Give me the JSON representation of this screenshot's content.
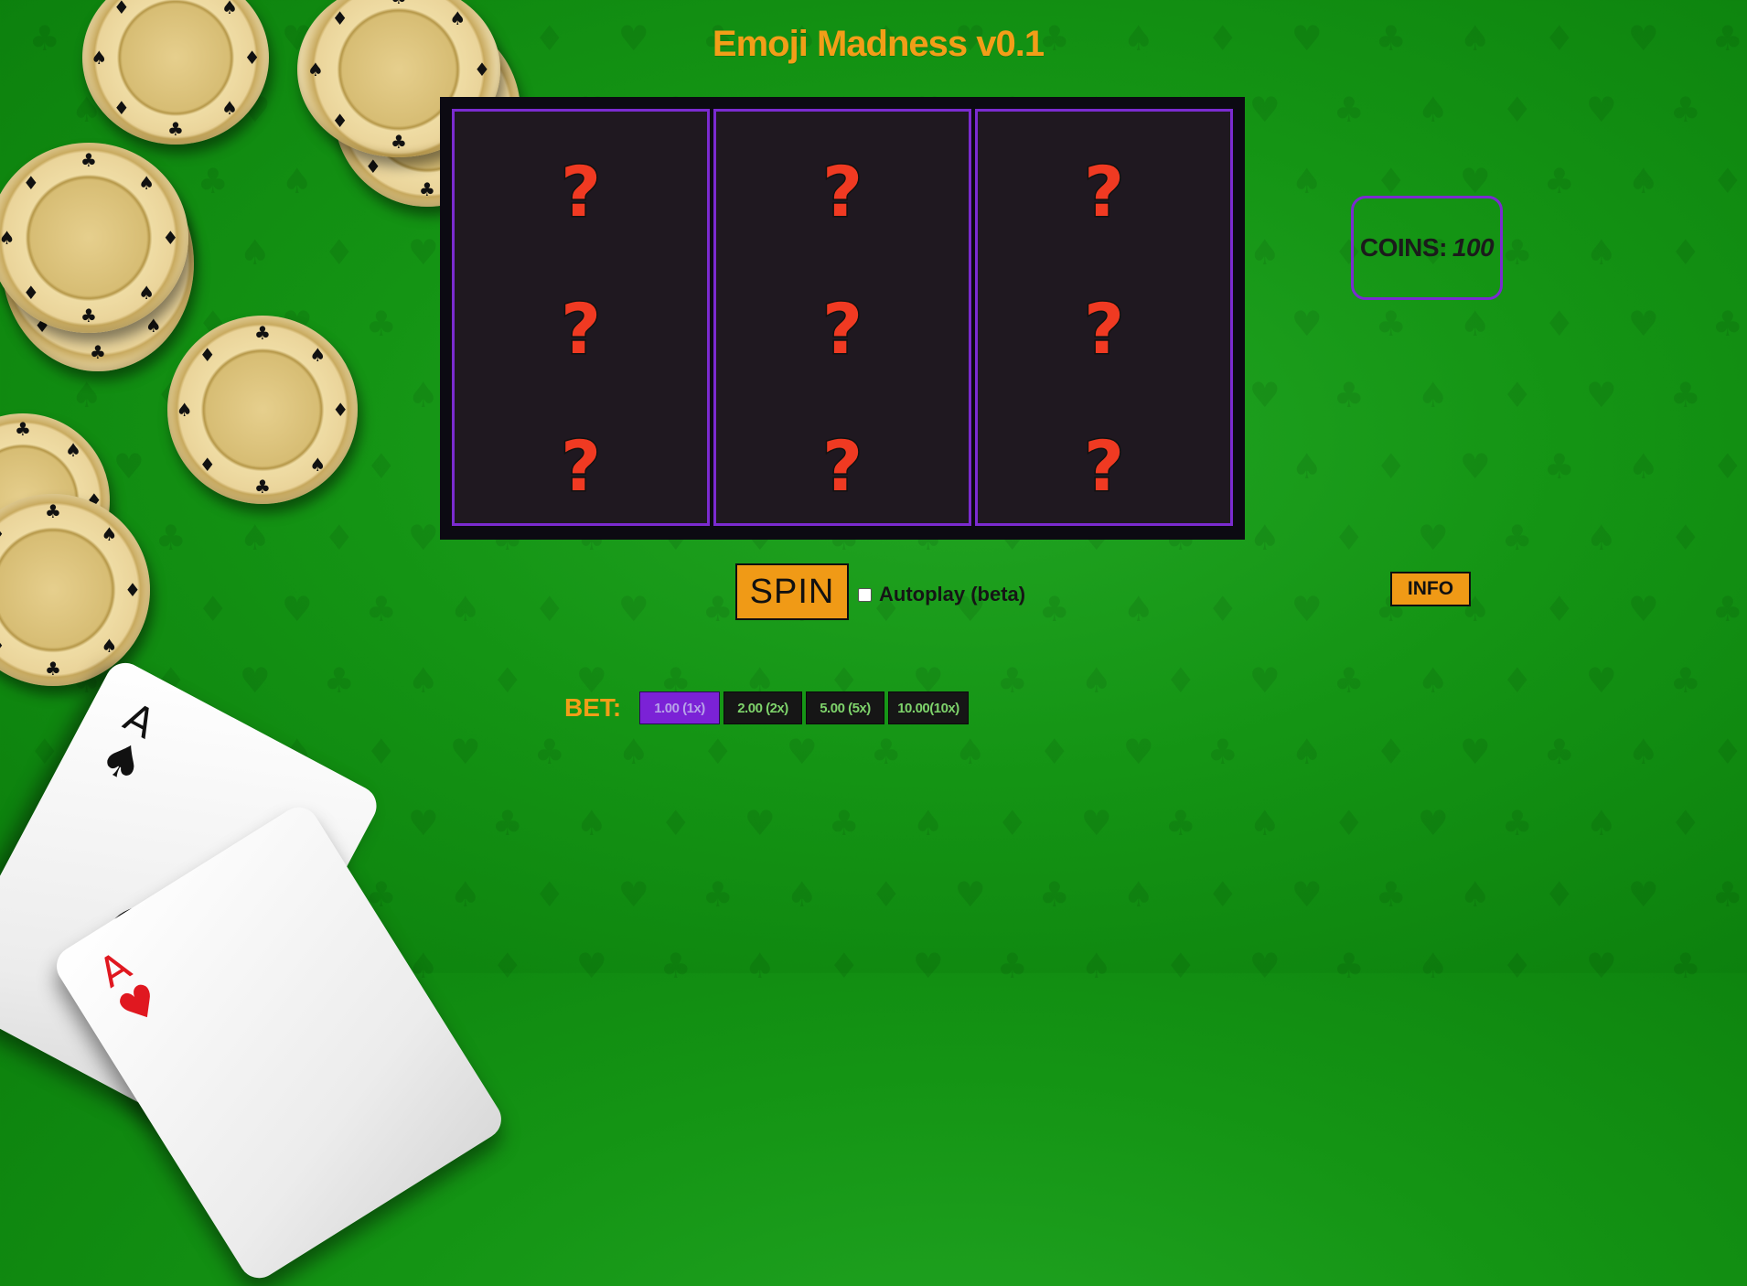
{
  "title": "Emoji Madness v0.1",
  "reels": [
    [
      "?",
      "?",
      "?"
    ],
    [
      "?",
      "?",
      "?"
    ],
    [
      "?",
      "?",
      "?"
    ]
  ],
  "coins": {
    "label": "COINS:",
    "value": "100"
  },
  "spin": {
    "label": "SPIN"
  },
  "autoplay": {
    "label": "Autoplay (beta)",
    "checked": false
  },
  "info": {
    "label": "INFO"
  },
  "bet": {
    "label": "BET:",
    "options": [
      {
        "label": "1.00 (1x)",
        "selected": true
      },
      {
        "label": "2.00 (2x)",
        "selected": false
      },
      {
        "label": "5.00 (5x)",
        "selected": false
      },
      {
        "label": "10.00(10x)",
        "selected": false
      }
    ]
  },
  "decor": {
    "card1_rank": "A",
    "card2_rank": "A",
    "colors": {
      "felt": "#149414",
      "accent_orange": "#f09a16",
      "accent_purple": "#7b2bd0",
      "reel_bg": "#1f1820",
      "symbol_red": "#f03a22"
    }
  }
}
